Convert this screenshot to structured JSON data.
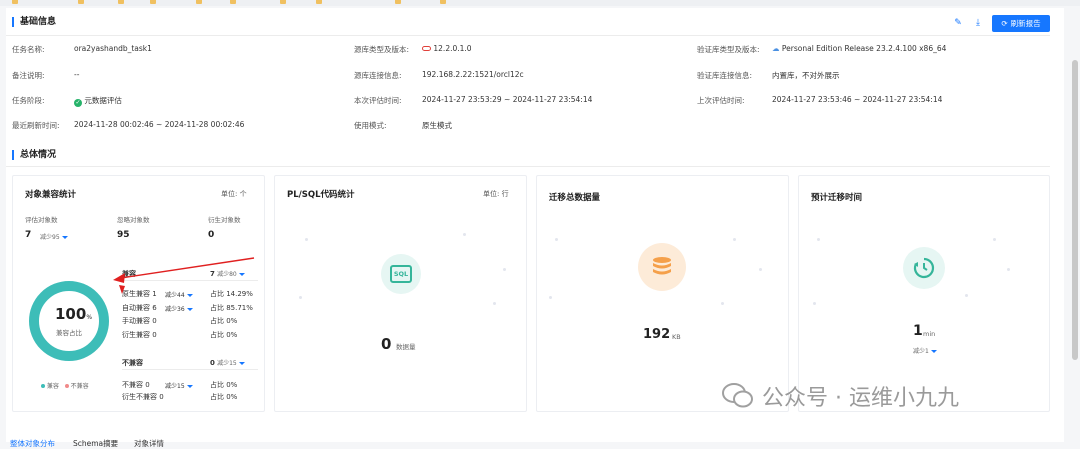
{
  "basic": {
    "title": "基础信息",
    "refresh_label": "刷新报告",
    "fields": {
      "task_name_label": "任务名称:",
      "task_name": "ora2yashandb_task1",
      "note_label": "备注说明:",
      "note": "--",
      "stage_label": "任务阶段:",
      "stage": "元数据评估",
      "last_refresh_label": "最近刷新时间:",
      "last_refresh": "2024-11-28 00:02:46 ~ 2024-11-28 00:02:46",
      "source_type_label": "源库类型及版本:",
      "source_type": "12.2.0.1.0",
      "source_conn_label": "源库连接信息:",
      "source_conn": "192.168.2.22:1521/orcl12c",
      "this_eval_label": "本次评估时间:",
      "this_eval": "2024-11-27 23:53:29 ~ 2024-11-27 23:54:14",
      "mode_label": "使用模式:",
      "mode": "原生模式",
      "verify_type_label": "验证库类型及版本:",
      "verify_type": "Personal Edition Release 23.2.4.100 x86_64",
      "verify_conn_label": "验证库连接信息:",
      "verify_conn": "内置库，不对外展示",
      "last_eval_label": "上次评估时间:",
      "last_eval": "2024-11-27 23:53:46 ~ 2024-11-27 23:54:14"
    }
  },
  "overview": {
    "title": "总体情况",
    "compat": {
      "title": "对象兼容统计",
      "unit": "单位: 个",
      "eval_label": "评估对象数",
      "eval_value": "7",
      "eval_delta": "减少95",
      "ignore_label": "忽略对象数",
      "ignore_value": "95",
      "derive_label": "衍生对象数",
      "derive_value": "0",
      "donut_value": "100",
      "donut_unit": "%",
      "donut_label": "兼容占比",
      "legend_compat": "兼容",
      "legend_incompat": "不兼容",
      "compat_head": "兼容",
      "compat_head_value": "7",
      "compat_head_delta": "减少80",
      "rows": [
        {
          "name": "原生兼容 1",
          "delta": "减少44",
          "ratio": "占比 14.29%"
        },
        {
          "name": "自动兼容 6",
          "delta": "减少36",
          "ratio": "占比 85.71%"
        },
        {
          "name": "手动兼容 0",
          "delta": "",
          "ratio": "占比 0%"
        },
        {
          "name": "衍生兼容 0",
          "delta": "",
          "ratio": "占比 0%"
        }
      ],
      "incompat_head": "不兼容",
      "incompat_head_value": "0",
      "incompat_head_delta": "减少15",
      "incompat_rows": [
        {
          "name": "不兼容 0",
          "delta": "减少15",
          "ratio": "占比 0%"
        },
        {
          "name": "衍生不兼容 0",
          "delta": "",
          "ratio": "占比 0%"
        }
      ]
    },
    "plsql": {
      "title": "PL/SQL代码统计",
      "unit": "单位: 行",
      "icon_text": "SQL",
      "value": "0",
      "value_label": "数据量"
    },
    "data": {
      "title": "迁移总数据量",
      "value": "192",
      "value_unit": "KB"
    },
    "time": {
      "title": "预计迁移时间",
      "value": "1",
      "value_unit": "min",
      "delta": "减少1"
    }
  },
  "tabs": [
    "整体对象分布",
    "Schema摘要",
    "对象详情"
  ],
  "watermark": {
    "text": "公众号 · 运维小九九"
  },
  "colors": {
    "accent": "#1677ff",
    "teal": "#3dbdb8",
    "orange": "#f5a04a",
    "red": "#e02020"
  }
}
